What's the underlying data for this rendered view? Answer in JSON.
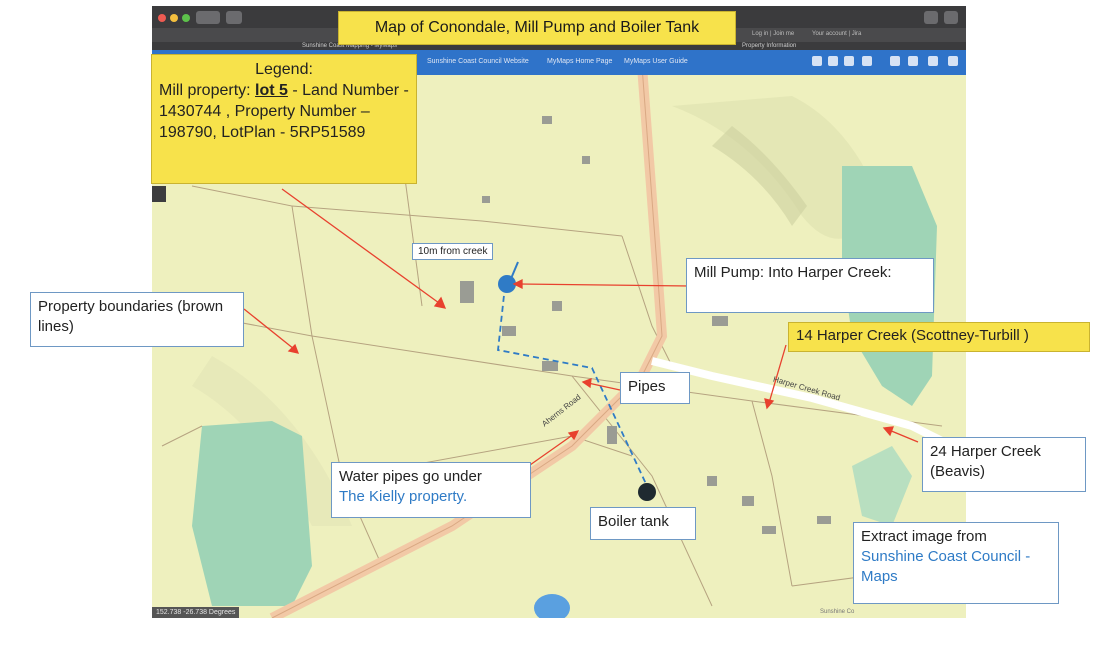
{
  "title": "Map of Conondale, Mill Pump and Boiler Tank",
  "browser": {
    "toolbar_links": [
      "Sunshine Coast Council Website",
      "MyMaps Home Page",
      "MyMaps User Guide"
    ],
    "nav_links": [
      "Log in | Join me",
      "Your account | Jira"
    ],
    "active_tab": "Sunshine Coast Mapping - MyMaps",
    "property_tab": "Property Information"
  },
  "legend": {
    "heading": "Legend:",
    "prefix": "Mill property: ",
    "lot": "lot 5",
    "rest": " - Land Number - 1430744 , Property Number – 198790, LotPlan - 5RP51589"
  },
  "annotations": {
    "creek_distance": "10m from creek",
    "mill_pump": "Mill Pump: Into Harper Creek:",
    "property_boundaries": "Property boundaries (brown lines)",
    "harper_14": "14 Harper Creek (Scottney-Turbill )",
    "pipes": "Pipes",
    "harper_24": "24 Harper Creek (Beavis)",
    "water_pipes_line1": "Water pipes go under",
    "water_pipes_line2": "The Kielly property.",
    "boiler_tank": "Boiler tank",
    "extract_line1": "Extract image from",
    "extract_line2": "Sunshine Coast Council -  Maps"
  },
  "map_labels": {
    "harper_creek_road": "Harper Creek Road",
    "aherns_road": "Aherns Road",
    "coords": "152.738 -26.738 Degrees",
    "footer": "Sunshine Co"
  },
  "colors": {
    "map_bg": "#eef0be",
    "forest": "#9fd4b6",
    "road": "#f2c9a6",
    "pump_marker": "#2f7bc6",
    "boiler_marker": "#1f2a30",
    "legend_bg": "#f7e24b",
    "toolbar": "#2f73c9"
  }
}
